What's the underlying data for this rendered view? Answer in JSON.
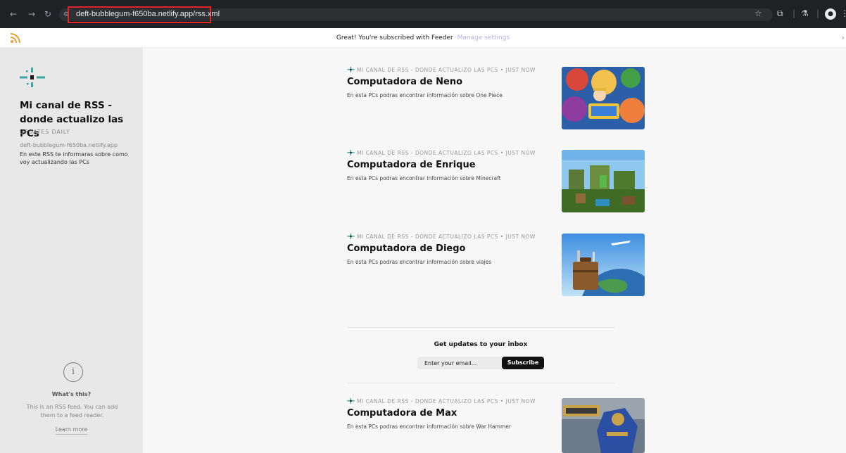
{
  "browser": {
    "url": "deft-bubblegum-f650ba.netlify.app/rss.xml"
  },
  "feeder_bar": {
    "message": "Great! You're subscribed with Feeder",
    "manage_link": "Manage settings"
  },
  "sidebar": {
    "title": "Mi canal de RSS - donde actualizo las PCs",
    "frequency": "UPDATES DAILY",
    "domain": "deft-bubblegum-f650ba.netlify.app",
    "description": "En este RSS te informaras sobre como voy actualizando las PCs",
    "whats_this_title": "What's this?",
    "whats_this_desc": "This is an RSS feed. You can add them to a feed reader.",
    "learn_more": "Learn more"
  },
  "items": [
    {
      "meta": "MI CANAL DE RSS - DONDE ACTUALIZO LAS PCS • JUST NOW",
      "title": "Computadora de Neno",
      "description": "En esta PCs podras encontrar información sobre One Piece"
    },
    {
      "meta": "MI CANAL DE RSS - DONDE ACTUALIZO LAS PCS • JUST NOW",
      "title": "Computadora de Enrique",
      "description": "En esta PCs podras encontrar información sobre Minecraft"
    },
    {
      "meta": "MI CANAL DE RSS - DONDE ACTUALIZO LAS PCS • JUST NOW",
      "title": "Computadora de Diego",
      "description": "En esta PCs podras encontrar información sobre viajes"
    },
    {
      "meta": "MI CANAL DE RSS - DONDE ACTUALIZO LAS PCS • JUST NOW",
      "title": "Computadora de Max",
      "description": "En esta PCs podras encontrar información sobre War Hammer"
    }
  ],
  "subscribe": {
    "title": "Get updates to your inbox",
    "placeholder": "Enter your email...",
    "button": "Subscribe"
  },
  "colors": {
    "accent": "#3ba5a0",
    "highlight": "#e3242b",
    "manage_link": "#b4b0e8"
  },
  "icons": {
    "rss": "rss-icon",
    "logo": "netlify-logo-icon",
    "info": "info-icon"
  }
}
